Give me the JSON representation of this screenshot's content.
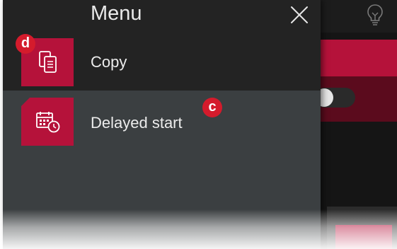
{
  "menu": {
    "title": "Menu",
    "items": [
      {
        "label": "Copy",
        "icon": "copy-icon",
        "annotation": "d"
      },
      {
        "label": "Delayed start",
        "icon": "calendar-clock-icon",
        "annotation": "c"
      }
    ]
  },
  "colors": {
    "accent": "#b5123a",
    "badge": "#d41b2c",
    "panel": "#3b3f41",
    "header": "#232323"
  }
}
